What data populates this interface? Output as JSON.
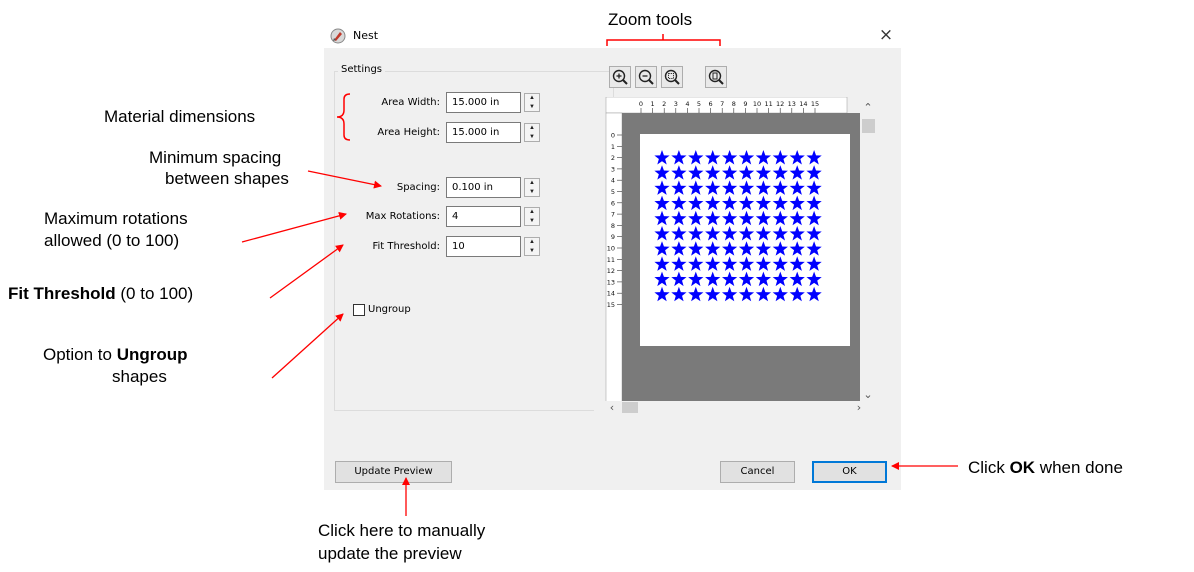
{
  "dialog": {
    "title": "Nest",
    "close": "×",
    "settings_title": "Settings",
    "fields": {
      "area_width": {
        "label": "Area Width:",
        "value": "15.000 in"
      },
      "area_height": {
        "label": "Area Height:",
        "value": "15.000 in"
      },
      "spacing": {
        "label": "Spacing:",
        "value": "0.100 in"
      },
      "max_rotations": {
        "label": "Max Rotations:",
        "value": "4"
      },
      "fit_threshold": {
        "label": "Fit Threshold:",
        "value": "10"
      }
    },
    "ungroup": {
      "label": "Ungroup",
      "checked": false
    },
    "zoom_buttons": [
      "zoom-in-icon",
      "zoom-out-icon",
      "zoom-fit-icon",
      "zoom-page-icon"
    ],
    "ruler": {
      "h_ticks": [
        "0",
        "1",
        "2",
        "3",
        "4",
        "5",
        "6",
        "7",
        "8",
        "9",
        "10",
        "11",
        "12",
        "13",
        "14",
        "15"
      ],
      "v_ticks": [
        "0",
        "1",
        "2",
        "3",
        "4",
        "5",
        "6",
        "7",
        "8",
        "9",
        "10",
        "11",
        "12",
        "13",
        "14",
        "15"
      ]
    },
    "preview": {
      "rows": 10,
      "cols": 10,
      "shape": "star",
      "shape_color": "#0000ff",
      "canvas_bg": "#7a7a7a"
    },
    "buttons": {
      "update_preview": "Update Preview",
      "cancel": "Cancel",
      "ok": "OK"
    }
  },
  "annotations": {
    "zoom_tools": "Zoom tools",
    "material_dimensions": "Material dimensions",
    "min_spacing_1": "Minimum spacing",
    "min_spacing_2": "between shapes",
    "max_rot_1": "Maximum rotations",
    "max_rot_2": "allowed (0 to 100)",
    "fit_threshold_bold": "Fit Threshold",
    "fit_threshold_rest": " (0 to 100)",
    "ungroup_pre": "Option to ",
    "ungroup_bold": "Ungroup",
    "ungroup_2": "shapes",
    "ok_pre": "Click ",
    "ok_bold": "OK",
    "ok_post": " when done",
    "update_1": "Click here to manually",
    "update_2": "update the preview"
  },
  "colors": {
    "arrow": "#ff0000",
    "ok_border": "#0078d7",
    "star": "#0000ff"
  }
}
